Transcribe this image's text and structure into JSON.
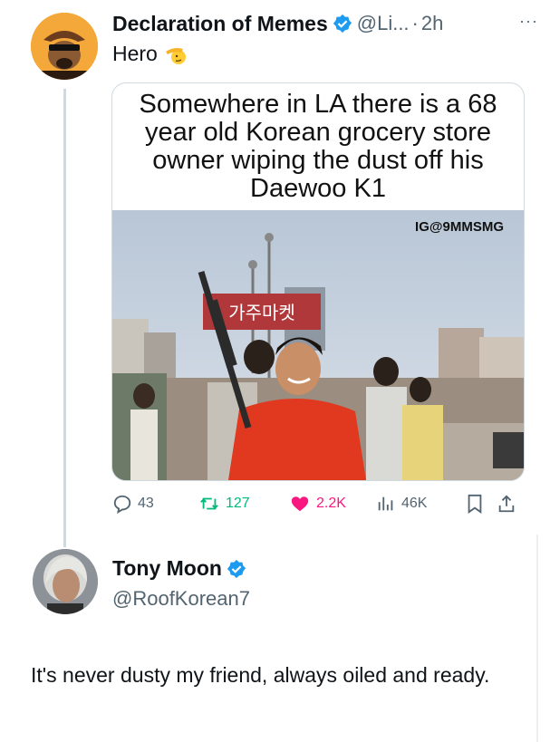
{
  "tweet": {
    "author": {
      "name": "Declaration of Memes",
      "handle": "@Li...",
      "time": "2h",
      "verified": true
    },
    "more_label": "···",
    "text": "Hero",
    "text_emoji": "saluting-face",
    "media": {
      "caption": "Somewhere in LA there is a 68 year old Korean grocery store owner wiping the dust off his Daewoo K1",
      "watermark": "IG@9MMSMG",
      "sign_text": "가주마켓"
    },
    "stats": {
      "replies": "43",
      "retweets": "127",
      "likes": "2.2K",
      "views": "46K"
    }
  },
  "reply": {
    "author": {
      "name": "Tony Moon",
      "handle": "@RoofKorean7",
      "verified": true
    },
    "text": "It's never dusty my friend, always oiled and ready."
  },
  "colors": {
    "verified": "#1d9bf0",
    "like": "#f91880",
    "retweet": "#00ba7c",
    "muted": "#536471",
    "text": "#0f1419"
  }
}
